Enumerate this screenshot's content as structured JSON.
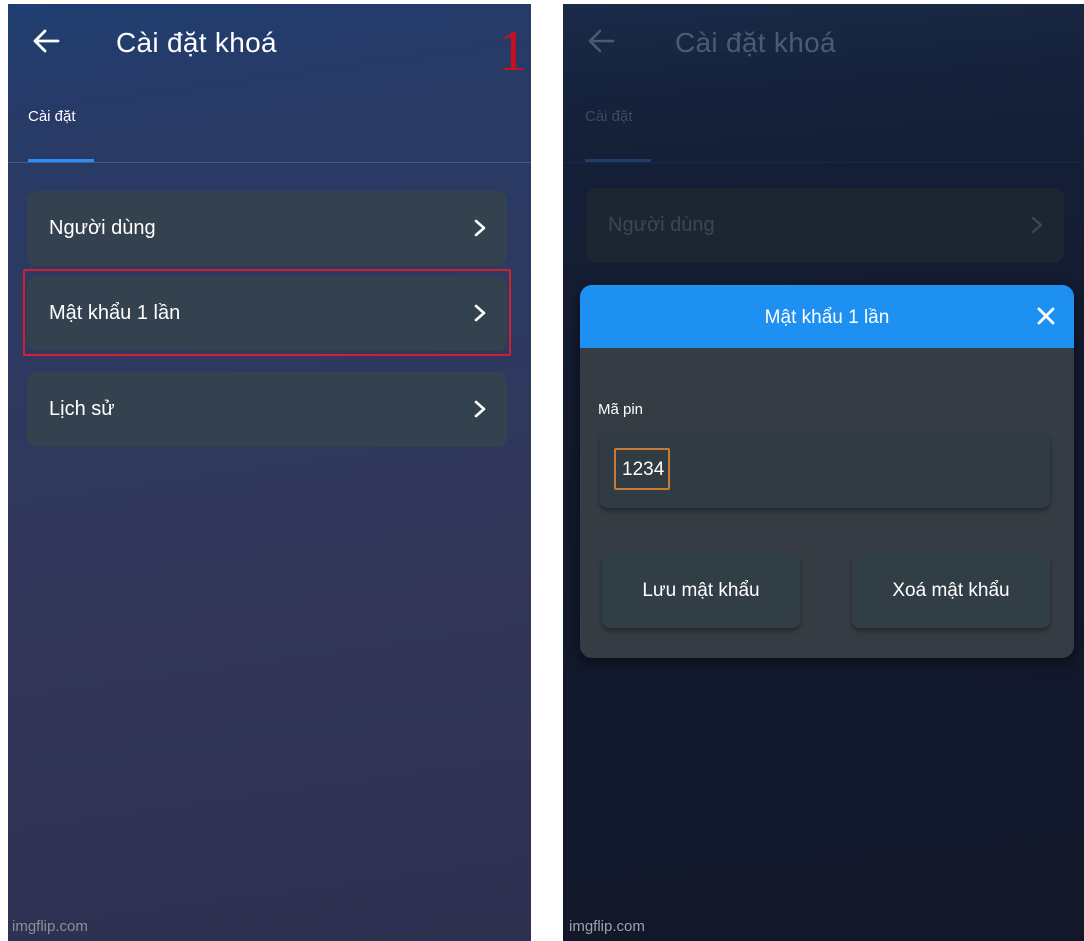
{
  "left_screen": {
    "header": {
      "title": "Cài đặt khoá",
      "back_icon": "arrow-left-icon"
    },
    "step_number": "1",
    "tab": {
      "label": "Cài đặt"
    },
    "menu": [
      {
        "label": "Người dùng",
        "icon": "chevron-right-icon"
      },
      {
        "label": "Mật khẩu 1 lần",
        "icon": "chevron-right-icon",
        "highlighted": true
      },
      {
        "label": "Lịch sử",
        "icon": "chevron-right-icon"
      }
    ],
    "watermark": "imgflip.com"
  },
  "right_screen": {
    "header": {
      "title": "Cài đặt khoá",
      "back_icon": "arrow-left-icon"
    },
    "tab": {
      "label": "Cài đặt"
    },
    "menu": [
      {
        "label": "Người dùng",
        "icon": "chevron-right-icon"
      }
    ],
    "modal": {
      "title": "Mật khẩu 1 lần",
      "close_icon": "close-icon",
      "field_label": "Mã pin",
      "pin_value": "1234",
      "save_label": "Lưu mật khẩu",
      "delete_label": "Xoá mật khẩu"
    },
    "watermark": "imgflip.com"
  },
  "colors": {
    "accent": "#1e90f2",
    "highlight_red": "#d4202e",
    "highlight_orange": "#c77a34",
    "card": "#34424f"
  }
}
